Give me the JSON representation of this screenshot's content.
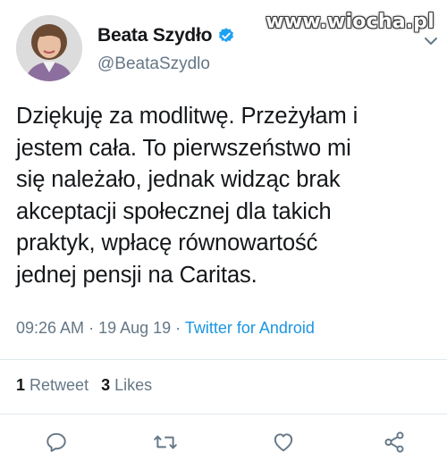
{
  "user": {
    "display_name": "Beata Szydło",
    "handle": "@BeataSzydlo",
    "verified": true,
    "avatar_icon": "profile-photo"
  },
  "watermark": "www.wiocha.pl",
  "tweet": {
    "lines": [
      "Dziękuję za modlitwę. Przeżyłam i",
      "jestem cała. To pierwszeństwo mi",
      "się należało, jednak widząc brak",
      "akceptacji społecznej dla takich",
      "praktyk, wpłacę równowartość",
      "jednej pensji na Caritas."
    ]
  },
  "meta": {
    "time": "09:26 AM",
    "separator1": " · ",
    "date": "19 Aug 19",
    "separator2": " · ",
    "source": "Twitter for Android"
  },
  "stats": {
    "retweets_count": "1",
    "retweets_label": "Retweet",
    "likes_count": "3",
    "likes_label": "Likes"
  },
  "actions": {
    "reply_icon": "reply-icon",
    "retweet_icon": "retweet-icon",
    "like_icon": "heart-icon",
    "share_icon": "share-icon"
  },
  "colors": {
    "text": "#14171a",
    "secondary": "#657786",
    "link": "#1b95e0",
    "verified": "#1da1f2",
    "divider": "#e1e8ed"
  }
}
